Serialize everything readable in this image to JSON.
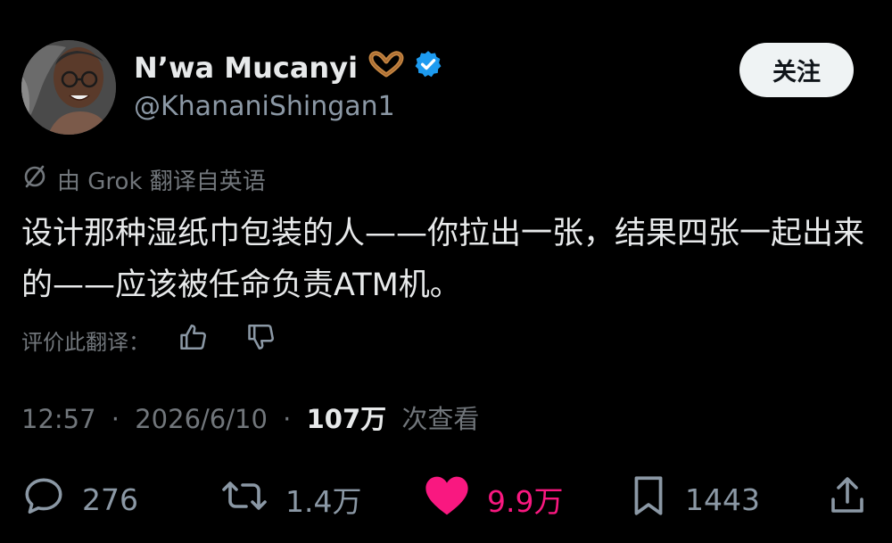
{
  "author": {
    "display_name": "N’wa Mucanyi",
    "handle": "@KhananiShingan1",
    "emoji_icon": "heart-hands-icon",
    "verified_icon": "verified-badge-icon",
    "verified_color": "#1d9bf0"
  },
  "follow_button": {
    "label": "关注"
  },
  "translation": {
    "notice": "由 Grok 翻译自英语",
    "icon": "slash-circle-icon"
  },
  "tweet": {
    "text": "设计那种湿纸巾包装的人——你拉出一张，结果四张一起出来的——应该被任命负责ATM机。"
  },
  "rate_translation": {
    "label": "评价此翻译："
  },
  "meta": {
    "time": "12:57",
    "separator": "·",
    "date": "2026/6/10",
    "views_count": "107万",
    "views_label": "次查看"
  },
  "actions": {
    "replies": "276",
    "retweets": "1.4万",
    "likes": "9.9万",
    "bookmarks": "1443",
    "like_color": "#f91880"
  },
  "colors": {
    "background": "#000000",
    "primary_text": "#e7e9ea",
    "secondary_text": "#71767b",
    "follow_bg": "#eff3f4"
  }
}
